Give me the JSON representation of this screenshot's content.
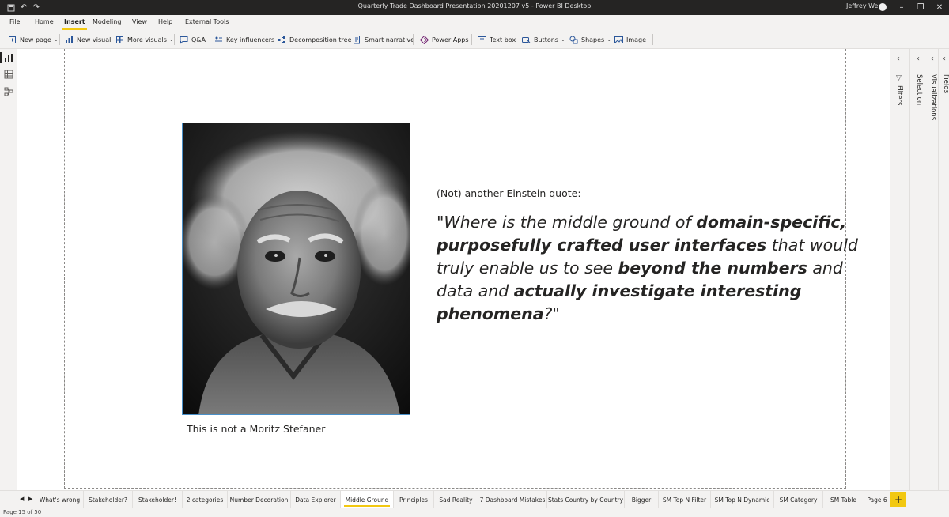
{
  "window": {
    "title": "Quarterly Trade Dashboard Presentation 20201207 v5 - Power BI Desktop",
    "user": "Jeffrey Weir"
  },
  "menu": {
    "items": [
      "File",
      "Home",
      "Insert",
      "Modeling",
      "View",
      "Help",
      "External Tools"
    ],
    "active": "Insert"
  },
  "ribbon": {
    "new_page": "New page",
    "new_visual": "New visual",
    "more_visuals": "More visuals",
    "qa": "Q&A",
    "key_influencers": "Key influencers",
    "decomposition_tree": "Decomposition tree",
    "smart_narrative": "Smart narrative",
    "power_apps": "Power Apps",
    "text_box": "Text box",
    "buttons": "Buttons",
    "shapes": "Shapes",
    "image": "Image"
  },
  "canvas": {
    "caption": "This is not a Moritz Stefaner",
    "quote_intro": "(Not) another Einstein quote:",
    "quote": {
      "q1": "\"Where is the middle ground of ",
      "b1": "domain-specific,",
      "b2": "purposefully crafted user interfaces",
      "q2": " that would truly enable us to see ",
      "b3": "beyond the numbers",
      "q3": " and data and ",
      "b4": "actually investigate interesting phenomena",
      "q4": "?\""
    }
  },
  "panes": {
    "filters": "Filters",
    "selection": "Selection",
    "visualizations": "Visualizations",
    "fields": "Fields"
  },
  "tabs": {
    "items": [
      "What's wrong",
      "Stakeholder?",
      "Stakeholder!",
      "2 categories",
      "Number Decoration",
      "Data Explorer",
      "Middle Ground",
      "Principles",
      "Sad Reality",
      "7 Dashboard Mistakes",
      "Stats Country by Country",
      "Bigger",
      "SM Top N Filter",
      "SM Top N Dynamic",
      "SM Category",
      "SM Table",
      "Page 6"
    ],
    "active": "Middle Ground",
    "add": "+"
  },
  "status": {
    "page_indicator": "Page 15 of 50"
  },
  "colors": {
    "accent": "#f2c811",
    "titlebar": "#252423",
    "photo_border": "#4a90c8"
  }
}
